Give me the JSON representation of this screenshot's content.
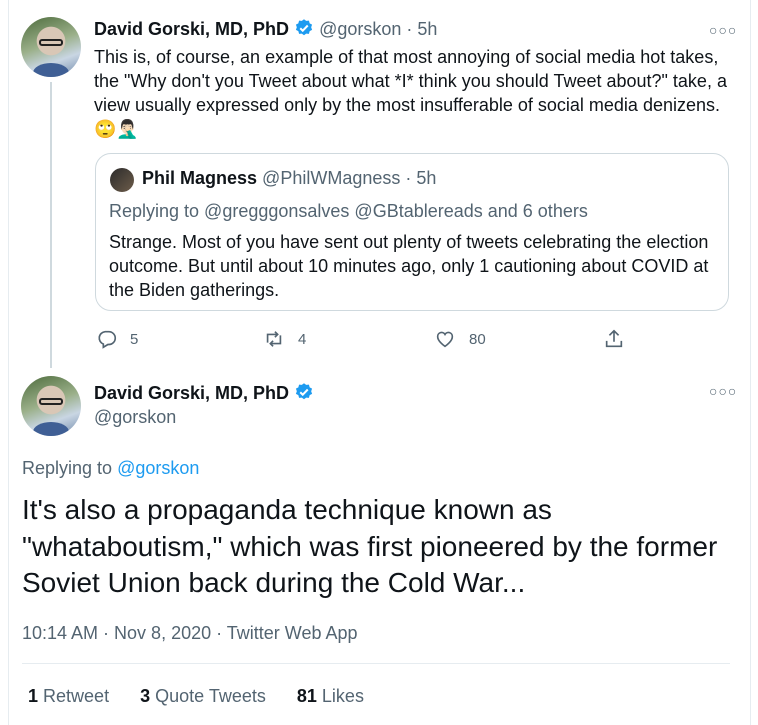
{
  "tweet1": {
    "name": "David Gorski, MD, PhD",
    "handle": "@gorskon",
    "time": "· 5h",
    "text": "This is, of course, an example of that most annoying of social media hot takes, the \"Why don't you Tweet about what *I* think you should Tweet about?\" take, a view usually expressed only by the most insufferable of social media denizens.🙄🤦🏻‍♂️",
    "quote": {
      "name": "Phil Magness",
      "handle": "@PhilWMagness",
      "time": "· 5h",
      "replying_to": "Replying to @gregggonsalves @GBtablereads and 6 others",
      "text": "Strange. Most of you have sent out plenty of tweets celebrating the election outcome. But until about 10 minutes ago, only 1 cautioning about COVID at the Biden gatherings."
    },
    "actions": {
      "reply_count": "5",
      "retweet_count": "4",
      "like_count": "80"
    }
  },
  "tweet2": {
    "name": "David Gorski, MD, PhD",
    "handle": "@gorskon",
    "replying_label": "Replying to ",
    "replying_handle": "@gorskon",
    "text": "It's also a propaganda technique known as \"whataboutism,\" which was first pioneered by the former Soviet Union back during the Cold War...",
    "meta": "10:14 AM · Nov 8, 2020 · Twitter Web App",
    "stats": {
      "retweets_num": "1",
      "retweets_label": "Retweet",
      "quotes_num": "3",
      "quotes_label": "Quote Tweets",
      "likes_num": "81",
      "likes_label": "Likes"
    }
  },
  "colors": {
    "accent": "#1d9bf0",
    "muted": "#536471",
    "border": "#cfd9de"
  }
}
